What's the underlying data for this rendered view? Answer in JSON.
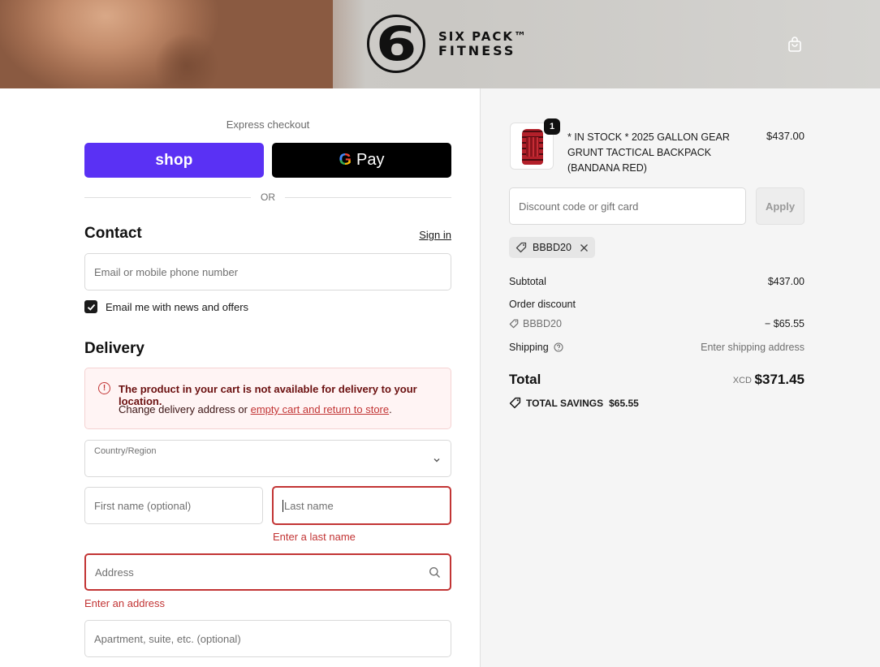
{
  "header": {
    "brand_line1": "SIX PACK™",
    "brand_line2": "FITNESS",
    "logo_glyph": "6",
    "cart_icon": "shopping-bag-icon"
  },
  "express": {
    "label": "Express checkout",
    "shop_label": "shop",
    "gpay_g": "G",
    "gpay_label": "Pay",
    "or_label": "OR",
    "shop_color": "#5a31f4"
  },
  "contact": {
    "title": "Contact",
    "sign_in": "Sign in",
    "email_placeholder": "Email or mobile phone number",
    "newsletter_label": "Email me with news and offers",
    "newsletter_checked": true
  },
  "delivery": {
    "title": "Delivery",
    "alert_title": "The product in your cart is not available for delivery to your location.",
    "alert_body_prefix": "Change delivery address or ",
    "alert_link": "empty cart and return to store",
    "alert_body_suffix": ".",
    "country_label": "Country/Region",
    "country_value": "",
    "first_name_placeholder": "First name (optional)",
    "last_name_placeholder": "Last name",
    "last_name_error": "Enter a last name",
    "address_placeholder": "Address",
    "address_error": "Enter an address",
    "apartment_placeholder": "Apartment, suite, etc. (optional)",
    "error_color": "#c23434"
  },
  "summary": {
    "item": {
      "quantity": "1",
      "name": "* IN STOCK * 2025 GALLON GEAR GRUNT TACTICAL BACKPACK (BANDANA RED)",
      "price": "$437.00"
    },
    "discount_placeholder": "Discount code or gift card",
    "apply_label": "Apply",
    "applied_code": "BBBD20",
    "subtotal_label": "Subtotal",
    "subtotal_value": "$437.00",
    "order_discount_label": "Order discount",
    "discount_code": "BBBD20",
    "discount_value": "− $65.55",
    "shipping_label": "Shipping",
    "shipping_value": "Enter shipping address",
    "total_label": "Total",
    "currency": "XCD",
    "total_value": "$371.45",
    "savings_label": "TOTAL SAVINGS",
    "savings_value": "$65.55"
  }
}
